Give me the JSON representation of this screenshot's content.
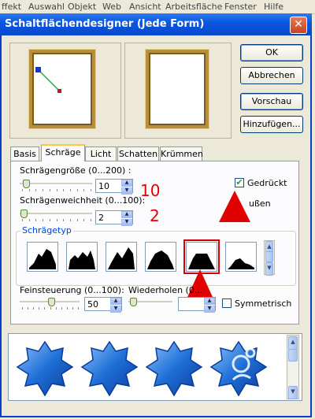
{
  "app_menu": [
    "ffekt",
    "Auswahl",
    "Objekt",
    "Web",
    "Ansicht",
    "Arbeitsfläche",
    "Fenster",
    "Hilfe"
  ],
  "dialog": {
    "title": "Schaltflächendesigner (Jede Form)",
    "close_glyph": "✕"
  },
  "buttons": {
    "ok": "OK",
    "cancel": "Abbrechen",
    "preview": "Vorschau",
    "add": "Hinzufügen..."
  },
  "tabs": [
    "Basis",
    "Schräge",
    "Licht",
    "Schatten",
    "Krümmen"
  ],
  "active_tab": "Schräge",
  "bevel": {
    "size_label": "Schrägengröße (0...200) :",
    "size_value": "10",
    "softness_label": "Schrägenweichheit (0...100):",
    "softness_value": "2",
    "pressed_label": "Gedrückt",
    "pressed_checked": true,
    "outer_label": "ußen",
    "type_label": "Schrägetyp",
    "fine_label": "Feinsteuerung (0...100):",
    "fine_value": "50",
    "repeat_label": "Wiederholen (0...",
    "symmetric_label": "Symmetrisch",
    "symmetric_checked": false,
    "selected_shape": 5
  },
  "annotations": {
    "size_note": "10",
    "softness_note": "2"
  },
  "colors": {
    "title_bar": "#0a58e0",
    "annotation_red": "#e00000",
    "star_blue": "#1e6fd6"
  },
  "icons": {
    "checkmark": "✔",
    "spin_up": "▲",
    "spin_down": "▼"
  }
}
